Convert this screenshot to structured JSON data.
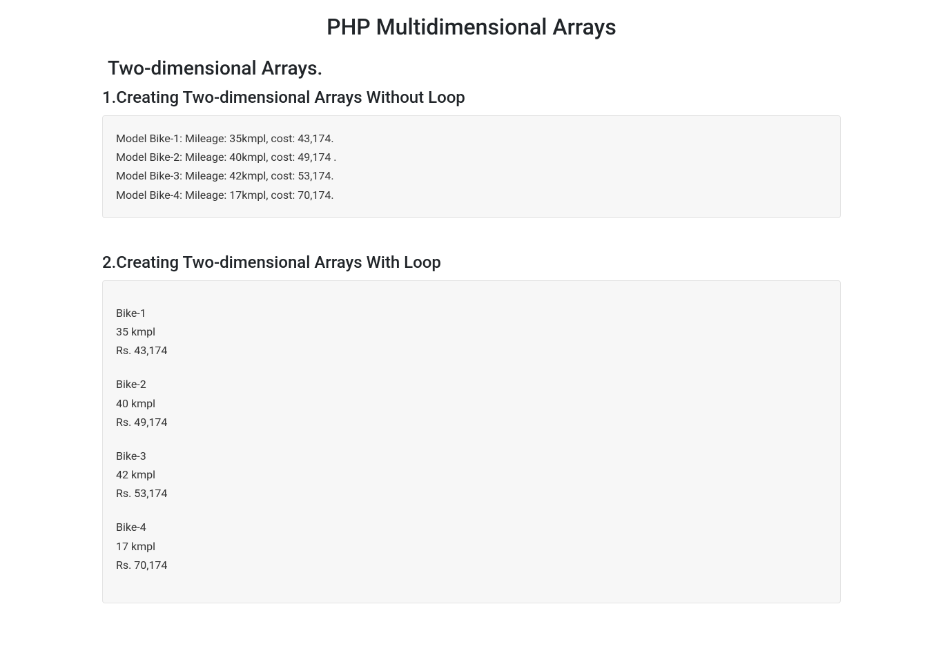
{
  "page": {
    "title": "PHP Multidimensional Arrays",
    "subtitle": "Two-dimensional Arrays."
  },
  "sections": {
    "without_loop": {
      "heading": "1.Creating Two-dimensional Arrays Without Loop",
      "lines": [
        "Model Bike-1: Mileage: 35kmpl, cost: 43,174.",
        "Model Bike-2: Mileage: 40kmpl, cost: 49,174 .",
        "Model Bike-3: Mileage: 42kmpl, cost: 53,174.",
        "Model Bike-4: Mileage: 17kmpl, cost: 70,174."
      ]
    },
    "with_loop": {
      "heading": "2.Creating Two-dimensional Arrays With Loop",
      "bikes": [
        {
          "model": "Bike-1",
          "mileage": "35 kmpl",
          "cost": "Rs. 43,174"
        },
        {
          "model": "Bike-2",
          "mileage": "40 kmpl",
          "cost": "Rs. 49,174"
        },
        {
          "model": "Bike-3",
          "mileage": "42 kmpl",
          "cost": "Rs. 53,174"
        },
        {
          "model": "Bike-4",
          "mileage": "17 kmpl",
          "cost": "Rs. 70,174"
        }
      ]
    }
  }
}
